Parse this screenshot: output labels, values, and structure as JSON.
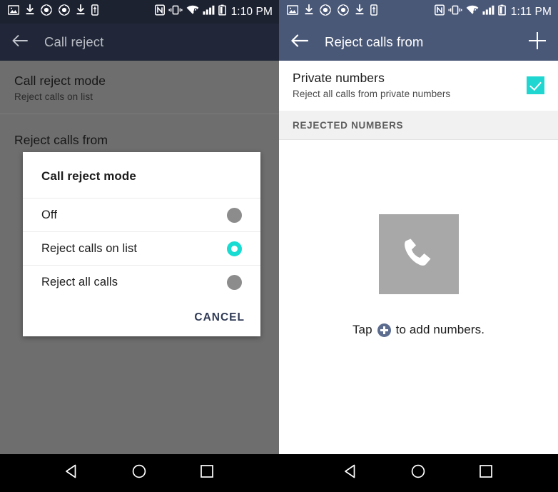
{
  "left_screen": {
    "status_bar": {
      "time": "1:10 PM",
      "left_icons": [
        "image-icon",
        "download-icon",
        "capture-icon",
        "capture-icon",
        "download-icon",
        "usb-icon"
      ],
      "right_icons": [
        "nfc-icon",
        "vibrate-icon",
        "wifi-secure-icon",
        "signal-icon",
        "battery-icon"
      ],
      "background": "#1d2231"
    },
    "app_bar": {
      "back_label": "back-arrow",
      "title": "Call reject",
      "background": "#212738"
    },
    "settings": [
      {
        "title": "Call reject mode",
        "subtitle": "Reject calls on list"
      },
      {
        "title": "Reject calls from",
        "subtitle": ""
      }
    ],
    "dialog": {
      "title": "Call reject mode",
      "options": [
        {
          "label": "Off",
          "selected": false
        },
        {
          "label": "Reject calls on list",
          "selected": true
        },
        {
          "label": "Reject all calls",
          "selected": false
        }
      ],
      "cancel_label": "CANCEL",
      "accent_color": "#18dbd2",
      "cancel_color": "#2f3a55"
    }
  },
  "right_screen": {
    "status_bar": {
      "time": "1:11 PM",
      "left_icons": [
        "image-icon",
        "download-icon",
        "capture-icon",
        "capture-icon",
        "download-icon",
        "usb-icon"
      ],
      "right_icons": [
        "nfc-icon",
        "vibrate-icon",
        "wifi-secure-icon",
        "signal-icon",
        "battery-icon"
      ],
      "background": "#4a5878"
    },
    "app_bar": {
      "title": "Reject calls from",
      "add_label": "add",
      "background": "#4a5878"
    },
    "private_numbers": {
      "title": "Private numbers",
      "subtitle": "Reject all calls from private numbers",
      "checked": true,
      "check_color": "#1fd6d0"
    },
    "section_header": "REJECTED NUMBERS",
    "empty_state": {
      "icon": "phone-icon",
      "text_before": "Tap",
      "text_after": "to add numbers."
    }
  },
  "nav_bar": {
    "back": "back-triangle",
    "home": "home-circle",
    "recents": "recents-square"
  }
}
